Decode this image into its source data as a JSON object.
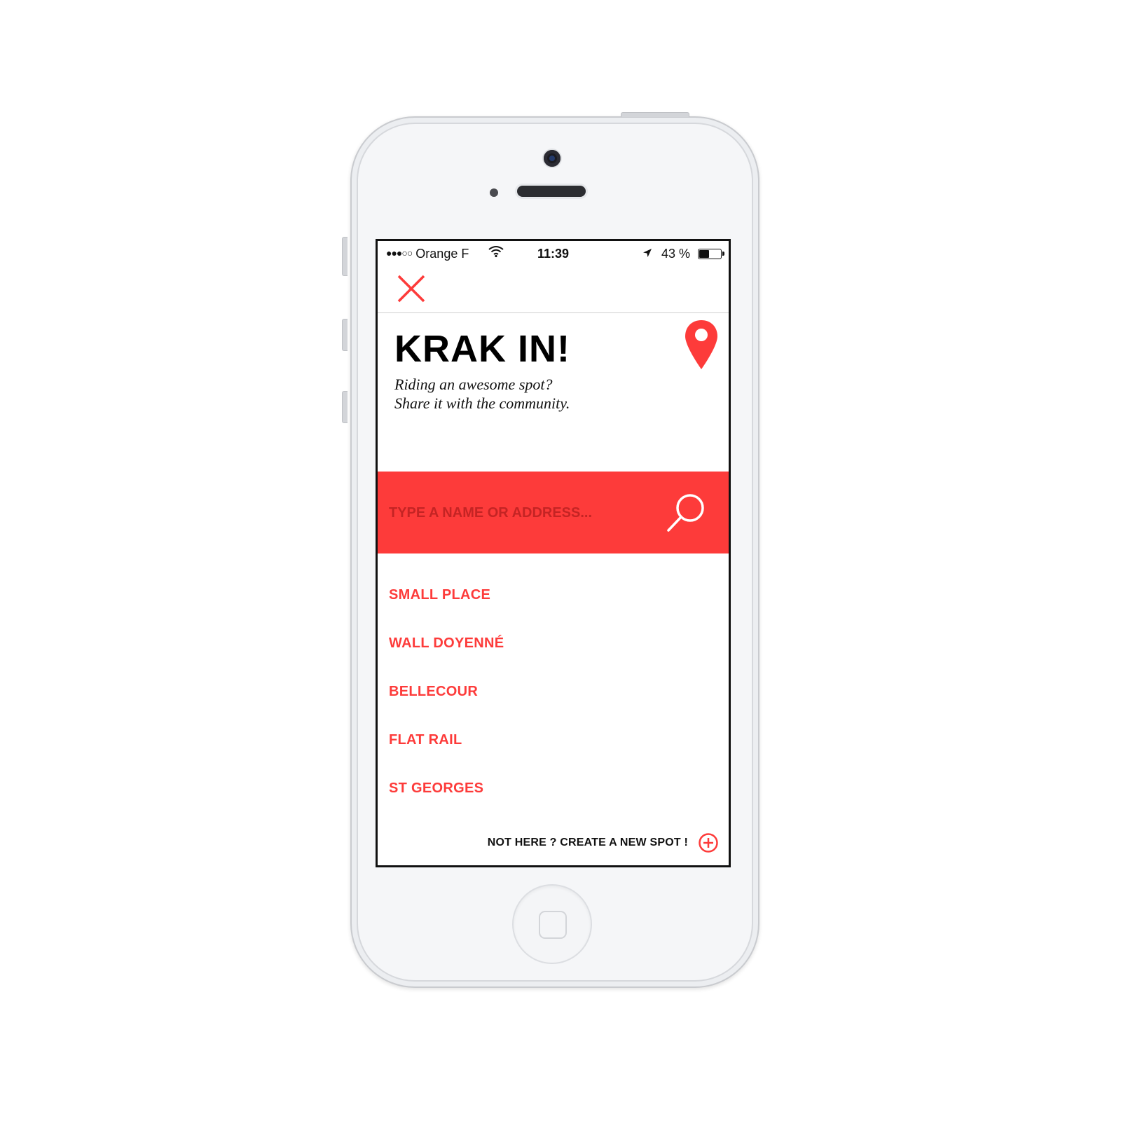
{
  "status_bar": {
    "signal_dots": "●●●○○",
    "carrier": "Orange F",
    "time": "11:39",
    "battery_text": "43 %",
    "battery_level": 0.43
  },
  "header": {
    "close_icon": "close-icon"
  },
  "hero": {
    "title": "KRAK IN!",
    "subtitle_line1": "Riding an awesome spot?",
    "subtitle_line2": "Share it with the community.",
    "pin_icon": "map-pin-icon"
  },
  "search": {
    "placeholder": "TYPE A NAME OR ADDRESS...",
    "value": "",
    "icon": "search-icon"
  },
  "spots": [
    {
      "label": "SMALL PLACE"
    },
    {
      "label": "WALL DOYENNÉ"
    },
    {
      "label": "BELLECOUR"
    },
    {
      "label": "FLAT RAIL"
    },
    {
      "label": "ST GEORGES"
    }
  ],
  "footer": {
    "create_label": "NOT HERE ? CREATE A NEW SPOT !",
    "icon": "add-circle-icon"
  },
  "colors": {
    "accent": "#fd3b3a",
    "text": "#111111",
    "placeholder": "#c42424"
  }
}
